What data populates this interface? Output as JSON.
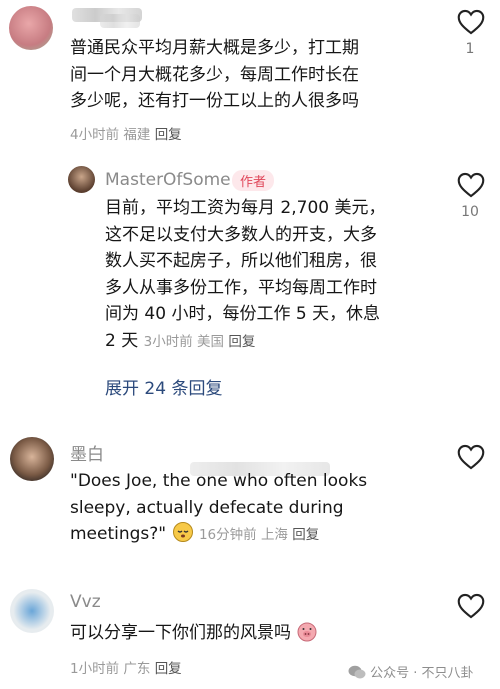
{
  "comments": [
    {
      "text_lines": [
        "普通民众平均月薪大概是多少，打工期",
        "间一个月大概花多少，每周工作时长在",
        "多少呢，还有打一份工以上的人很多吗"
      ],
      "time": "4小时前",
      "location": "福建",
      "reply": "回复",
      "likes": "1"
    },
    {
      "name": "MasterOfSome",
      "author_tag": "作者",
      "text_lines": [
        "目前，平均工资为每月 2,700 美元，",
        "这不足以支付大多数人的开支，大多",
        "数人买不起房子，所以他们租房，很",
        "多人从事多份工作，平均每周工作时",
        "间为 40 小时，每份工作 5 天，休息"
      ],
      "last_line": "2 天",
      "time": "3小时前",
      "location": "美国",
      "reply": "回复",
      "likes": "10",
      "expand": "展开 24 条回复"
    },
    {
      "name": "墨白",
      "text_lines": [
        "\"Does Joe, the one who often looks",
        "sleepy, actually defecate during"
      ],
      "last_line": "meetings?\"",
      "time": "16分钟前",
      "location": "上海",
      "reply": "回复"
    },
    {
      "name": "Vvz",
      "text_lines": [
        "可以分享一下你们那的风景吗"
      ],
      "time": "1小时前",
      "location": "广东",
      "reply": "回复"
    }
  ],
  "watermark": "公众号 · 不只八卦",
  "icons": {
    "like": "heart-outline-icon",
    "wechat": "wechat-icon"
  }
}
